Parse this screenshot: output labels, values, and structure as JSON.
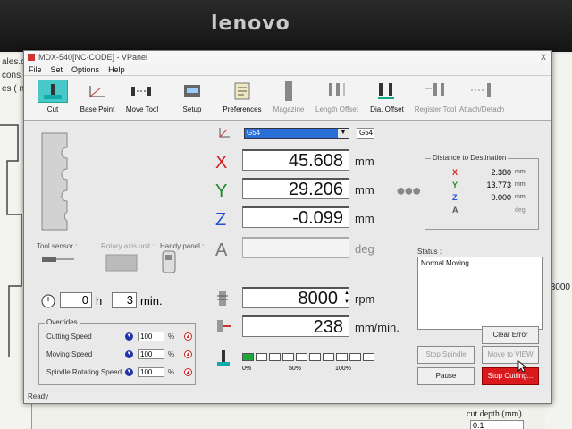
{
  "bezel": {
    "brand": "lenovo"
  },
  "background": {
    "left_texts": [
      "ales.c",
      "cons",
      "es ( ni"
    ],
    "right_texts": [
      "8000"
    ],
    "bottom_label": "cut depth (mm)",
    "bottom_value": "0.1"
  },
  "window": {
    "title": "MDX-540[NC-CODE] - VPanel",
    "close": "X",
    "menu": [
      "File",
      "Set",
      "Options",
      "Help"
    ],
    "toolbar": [
      {
        "label": "Cut",
        "icon": "cut-icon",
        "disabled": false,
        "active": true
      },
      {
        "label": "Base Point",
        "icon": "base-point-icon",
        "disabled": false,
        "active": false
      },
      {
        "label": "Move Tool",
        "icon": "move-tool-icon",
        "disabled": false,
        "active": false
      },
      {
        "label": "Setup",
        "icon": "setup-icon",
        "disabled": false,
        "active": false
      },
      {
        "label": "Preferences",
        "icon": "preferences-icon",
        "disabled": false,
        "active": false
      },
      {
        "label": "Magazine",
        "icon": "magazine-icon",
        "disabled": true,
        "active": false
      },
      {
        "label": "Length Offset",
        "icon": "length-offset-icon",
        "disabled": true,
        "active": false
      },
      {
        "label": "Dia. Offset",
        "icon": "dia-offset-icon",
        "disabled": false,
        "active": false
      },
      {
        "label": "Register Tool",
        "icon": "register-tool-icon",
        "disabled": true,
        "active": false
      },
      {
        "label": "Attach/Detach",
        "icon": "attach-detach-icon",
        "disabled": true,
        "active": false
      }
    ],
    "coord_system": {
      "selected": "G54",
      "code": "G54"
    },
    "axes": [
      {
        "name": "X",
        "value": "45.608",
        "unit": "mm",
        "color": "#d31f1f"
      },
      {
        "name": "Y",
        "value": "29.206",
        "unit": "mm",
        "color": "#1d8a2a"
      },
      {
        "name": "Z",
        "value": "-0.099",
        "unit": "mm",
        "color": "#1f4fd1"
      },
      {
        "name": "A",
        "value": "",
        "unit": "deg",
        "color": "#777777"
      }
    ],
    "distance": {
      "title": "Distance to Destination",
      "rows": [
        {
          "axis": "X",
          "value": "2.380",
          "unit": "mm",
          "color": "#d31f1f"
        },
        {
          "axis": "Y",
          "value": "13.773",
          "unit": "mm",
          "color": "#1d8a2a"
        },
        {
          "axis": "Z",
          "value": "0.000",
          "unit": "mm",
          "color": "#1f4fd1"
        },
        {
          "axis": "A",
          "value": "",
          "unit": "deg",
          "color": "#555555"
        }
      ]
    },
    "tool_sensor_label": "Tool sensor :",
    "rotary_label": "Rotary axis unit :",
    "handy_label": "Handy panel :",
    "time": {
      "hours": "0",
      "h": "h",
      "minutes": "3",
      "min": "min."
    },
    "overrides": {
      "title": "Overrides",
      "rows": [
        {
          "label": "Cutting Speed",
          "value": "100",
          "unit": "%"
        },
        {
          "label": "Moving Speed",
          "value": "100",
          "unit": "%"
        },
        {
          "label": "Spindle Rotating Speed",
          "value": "100",
          "unit": "%"
        }
      ]
    },
    "spindle": {
      "value": "8000",
      "unit": "rpm"
    },
    "feed": {
      "value": "238",
      "unit": "mm/min."
    },
    "progress": {
      "fraction": 0.1,
      "labels": [
        "0%",
        "50%",
        "100%"
      ],
      "cells": 10
    },
    "status": {
      "label": "Status :",
      "text": "Normal Moving"
    },
    "buttons": {
      "clear_error": "Clear Error",
      "stop_spindle": "Stop Spindle",
      "move_to_view": "Move to VIEW",
      "pause": "Pause",
      "stop_cutting": "Stop Cutting..."
    },
    "statusbar": "Ready"
  }
}
